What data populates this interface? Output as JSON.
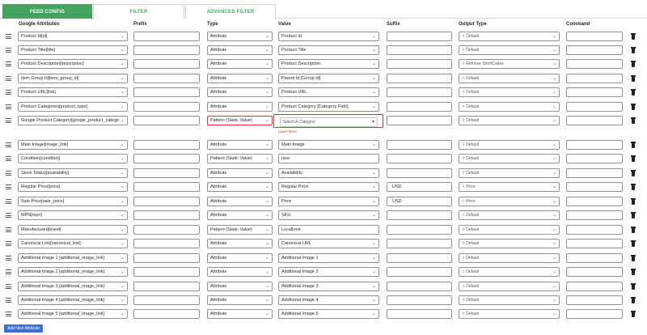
{
  "tabs": [
    {
      "label": "FEED CONFIG",
      "active": true
    },
    {
      "label": "FILTER",
      "active": false
    },
    {
      "label": "ADVANCED FILTER",
      "active": false
    }
  ],
  "columns": {
    "attributes": "Google Attributes",
    "prefix": "Prefix",
    "type": "Type",
    "value": "Value",
    "suffix": "Suffix",
    "output": "Output Type",
    "command": "Command"
  },
  "rows": [
    {
      "attr": "Product Id[id]",
      "prefix": "",
      "type": "Attribute",
      "value": "Product Id",
      "suffix": "",
      "output": "Default",
      "command": ""
    },
    {
      "attr": "Product Title[title]",
      "prefix": "",
      "type": "Attribute",
      "value": "Product Title",
      "suffix": "",
      "output": "Default",
      "command": ""
    },
    {
      "attr": "Product Description[description]",
      "prefix": "",
      "type": "Attribute",
      "value": "Product Description",
      "suffix": "",
      "output": "Remove ShortCodes",
      "command": ""
    },
    {
      "attr": "Item Group Id[item_group_id]",
      "prefix": "",
      "type": "Attribute",
      "value": "Parent Id [Group Id]",
      "suffix": "",
      "output": "Default",
      "command": ""
    },
    {
      "attr": "Product URL[link]",
      "prefix": "",
      "type": "Attribute",
      "value": "Product URL",
      "suffix": "",
      "output": "Default",
      "command": ""
    },
    {
      "attr": "Product Categories[product_type]",
      "prefix": "",
      "type": "Attribute",
      "value": "Product Category [Category Path]",
      "suffix": "",
      "output": "Default",
      "command": ""
    },
    {
      "attr": "Google Product Category[google_product_catego",
      "prefix": "",
      "type": "Pattern (Static Value)",
      "value": "Select A Category",
      "suffix": "",
      "output": "Default",
      "command": "",
      "learn_more": "Learn More.."
    },
    {
      "attr": "Main Image[image_link]",
      "prefix": "",
      "type": "Attribute",
      "value": "Main Image",
      "suffix": "",
      "output": "Default",
      "command": ""
    },
    {
      "attr": "Condition[condition]",
      "prefix": "",
      "type": "Pattern (Static Value)",
      "value": "new",
      "suffix": "",
      "output": "Default",
      "command": ""
    },
    {
      "attr": "Stock Status[availability]",
      "prefix": "",
      "type": "Attribute",
      "value": "Availability",
      "suffix": "",
      "output": "Default",
      "command": ""
    },
    {
      "attr": "Regular Price[price]",
      "prefix": "",
      "type": "Attribute",
      "value": "Regular Price",
      "suffix": "USD",
      "output": "Price",
      "command": ""
    },
    {
      "attr": "Sale Price[sale_price]",
      "prefix": "",
      "type": "Attribute",
      "value": "Price",
      "suffix": "USD",
      "output": "Price",
      "command": ""
    },
    {
      "attr": "MPN[mpn]",
      "prefix": "",
      "type": "Attribute",
      "value": "SKU",
      "suffix": "",
      "output": "Default",
      "command": ""
    },
    {
      "attr": "Manufacturer[brand]",
      "prefix": "",
      "type": "Pattern (Static Value)",
      "value": "Localhost",
      "suffix": "",
      "output": "Default",
      "command": ""
    },
    {
      "attr": "Canonical Link[canonical_link]",
      "prefix": "",
      "type": "Attribute",
      "value": "Canonical URL",
      "suffix": "",
      "output": "Default",
      "command": ""
    },
    {
      "attr": "Additional Image 1 [additional_image_link]",
      "prefix": "",
      "type": "Attribute",
      "value": "Additional Image 1",
      "suffix": "",
      "output": "Default",
      "command": ""
    },
    {
      "attr": "Additional Image 2 [additional_image_link]",
      "prefix": "",
      "type": "Attribute",
      "value": "Additional Image 2",
      "suffix": "",
      "output": "Default",
      "command": ""
    },
    {
      "attr": "Additional Image 3 [additional_image_link]",
      "prefix": "",
      "type": "Attribute",
      "value": "Additional Image 3",
      "suffix": "",
      "output": "Default",
      "command": ""
    },
    {
      "attr": "Additional Image 4 [additional_image_link]",
      "prefix": "",
      "type": "Attribute",
      "value": "Additional Image 4",
      "suffix": "",
      "output": "Default",
      "command": ""
    },
    {
      "attr": "Additional Image 5 [additional_image_link]",
      "prefix": "",
      "type": "Attribute",
      "value": "Additional Image 5",
      "suffix": "",
      "output": "Default",
      "command": ""
    }
  ],
  "add_button": "Add New Attribute",
  "colors": {
    "accent_green": "#43a35f",
    "tab_text_green": "#3bae5f",
    "button_blue": "#3d6fd9",
    "error_red": "#d63638"
  },
  "icons": {
    "drag": "drag-handle-icon",
    "delete": "trash-icon",
    "dropdown": "chevron-down-icon"
  }
}
